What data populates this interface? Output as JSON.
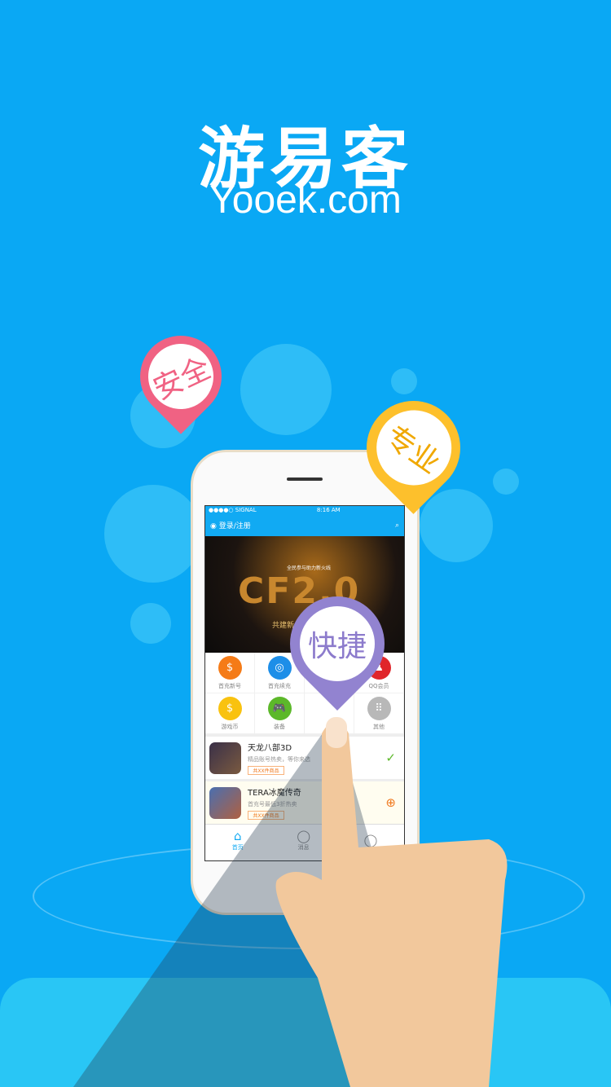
{
  "brand": {
    "title": "游易客",
    "subtitle": "Yooek.com"
  },
  "pins": [
    {
      "label": "安全",
      "color": "#f06283"
    },
    {
      "label": "专业",
      "color": "#fdc02c"
    },
    {
      "label": "快捷",
      "color": "#9283d0"
    }
  ],
  "phone": {
    "status": {
      "signal": "●●●●○ SIGNAL",
      "time": "8:16 AM"
    },
    "header": {
      "login": "登录/注册",
      "search_icon": "search-icon"
    },
    "banner": {
      "big": "CF2.0",
      "top": "全民参与助力新火线",
      "bottom": "共建新火线"
    },
    "grid": [
      {
        "label": "首充新号",
        "color": "#f57b17",
        "icon": "$"
      },
      {
        "label": "首充续充",
        "color": "#1d8ee8",
        "icon": "◎"
      },
      {
        "label": "",
        "color": "#ffffff",
        "icon": ""
      },
      {
        "label": "QQ会员",
        "color": "#e0252a",
        "icon": "♟"
      },
      {
        "label": "游戏币",
        "color": "#f9c20f",
        "icon": "$"
      },
      {
        "label": "装备",
        "color": "#5cb82a",
        "icon": "🎮"
      },
      {
        "label": "",
        "color": "#ffffff",
        "icon": ""
      },
      {
        "label": "其他",
        "color": "#b8b8b8",
        "icon": "⠿"
      }
    ],
    "list": [
      {
        "name": "天龙八部3D",
        "desc": "精品账号热卖，等你来选",
        "tag": "共XX件商品",
        "action": "✓",
        "action_color": "#5cb82a"
      },
      {
        "name": "TERA冰魔传奇",
        "desc": "首充号最低3折热卖",
        "tag": "共XX件商品",
        "action": "⊕",
        "action_color": "#f07a20"
      }
    ],
    "tabs": [
      {
        "label": "首页"
      },
      {
        "label": "消息"
      },
      {
        "label": ""
      }
    ]
  }
}
